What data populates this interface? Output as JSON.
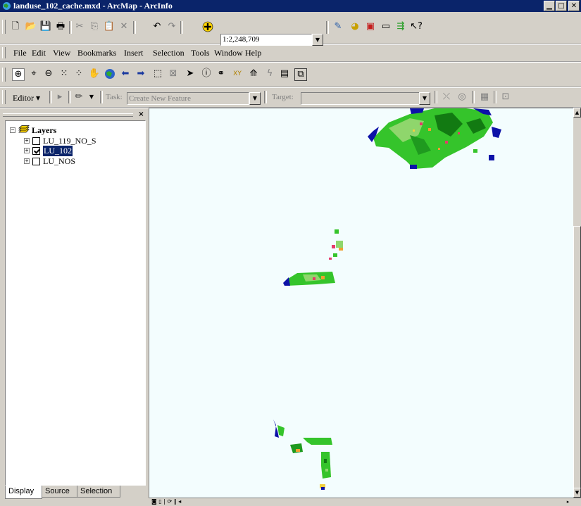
{
  "window": {
    "title": "landuse_102_cache.mxd - ArcMap - ArcInfo",
    "min_glyph": "▁",
    "max_glyph": "□",
    "close_glyph": "✕"
  },
  "standard_toolbar": {
    "scale_value": "1:2,248,709"
  },
  "menu": {
    "items": [
      "File",
      "Edit",
      "View",
      "Bookmarks",
      "Insert",
      "Selection",
      "Tools",
      "Window",
      "Help"
    ]
  },
  "editor_toolbar": {
    "editor_label": "Editor",
    "task_label": "Task:",
    "task_value": "Create New Feature",
    "target_label": "Target:",
    "target_value": ""
  },
  "toc": {
    "root_label": "Layers",
    "layers": [
      {
        "name": "LU_119_NO_S",
        "checked": false,
        "selected": false
      },
      {
        "name": "LU_102",
        "checked": true,
        "selected": true
      },
      {
        "name": "LU_NOS",
        "checked": false,
        "selected": false
      }
    ],
    "tabs": [
      "Display",
      "Source",
      "Selection"
    ]
  },
  "colors": {
    "title_bar": "#0a246a",
    "chrome": "#d4d0c8",
    "map_background": "#f3fdfe",
    "landuse_green": "#35c42b",
    "landuse_dark": "#127a12",
    "water_blue": "#0d12a8"
  }
}
